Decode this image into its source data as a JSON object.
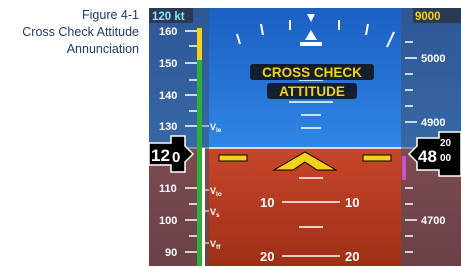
{
  "figure": {
    "number": "Figure 4-1",
    "title_line1": "Cross Check Attitude",
    "title_line2": "Annunciation"
  },
  "pfd": {
    "speed_unit": "120 kt",
    "airspeed_current_big": "12",
    "airspeed_current_digit": "0",
    "airspeed_ticks": [
      "160",
      "150",
      "140",
      "130",
      "110",
      "100",
      "90"
    ],
    "speed_bugs": {
      "vle": "V",
      "vle_sub": "le",
      "vlo": "V",
      "vlo_sub": "lo",
      "vs": "V",
      "vs_sub": "s",
      "vfe": "V",
      "vfe_sub": "ff"
    },
    "annunciation_line1": "CROSS CHECK",
    "annunciation_line2": "ATTITUDE",
    "pitch_upper_right": "10",
    "pitch_upper_left": "10",
    "pitch_lower_left": "20",
    "pitch_lower_right": "20",
    "altitude_top": "9000",
    "altitude_ticks": [
      "5000",
      "4900",
      "4700"
    ],
    "altitude_current_big": "48",
    "altitude_current_small_top": "20",
    "altitude_current_small_bot": "00",
    "colors": {
      "sky": "#1f6fd1",
      "ground": "#b83a1c",
      "annunciation": "#f2d21a",
      "tape_bg": "#3a4e72",
      "altitude_top": "#f2d21a"
    }
  }
}
